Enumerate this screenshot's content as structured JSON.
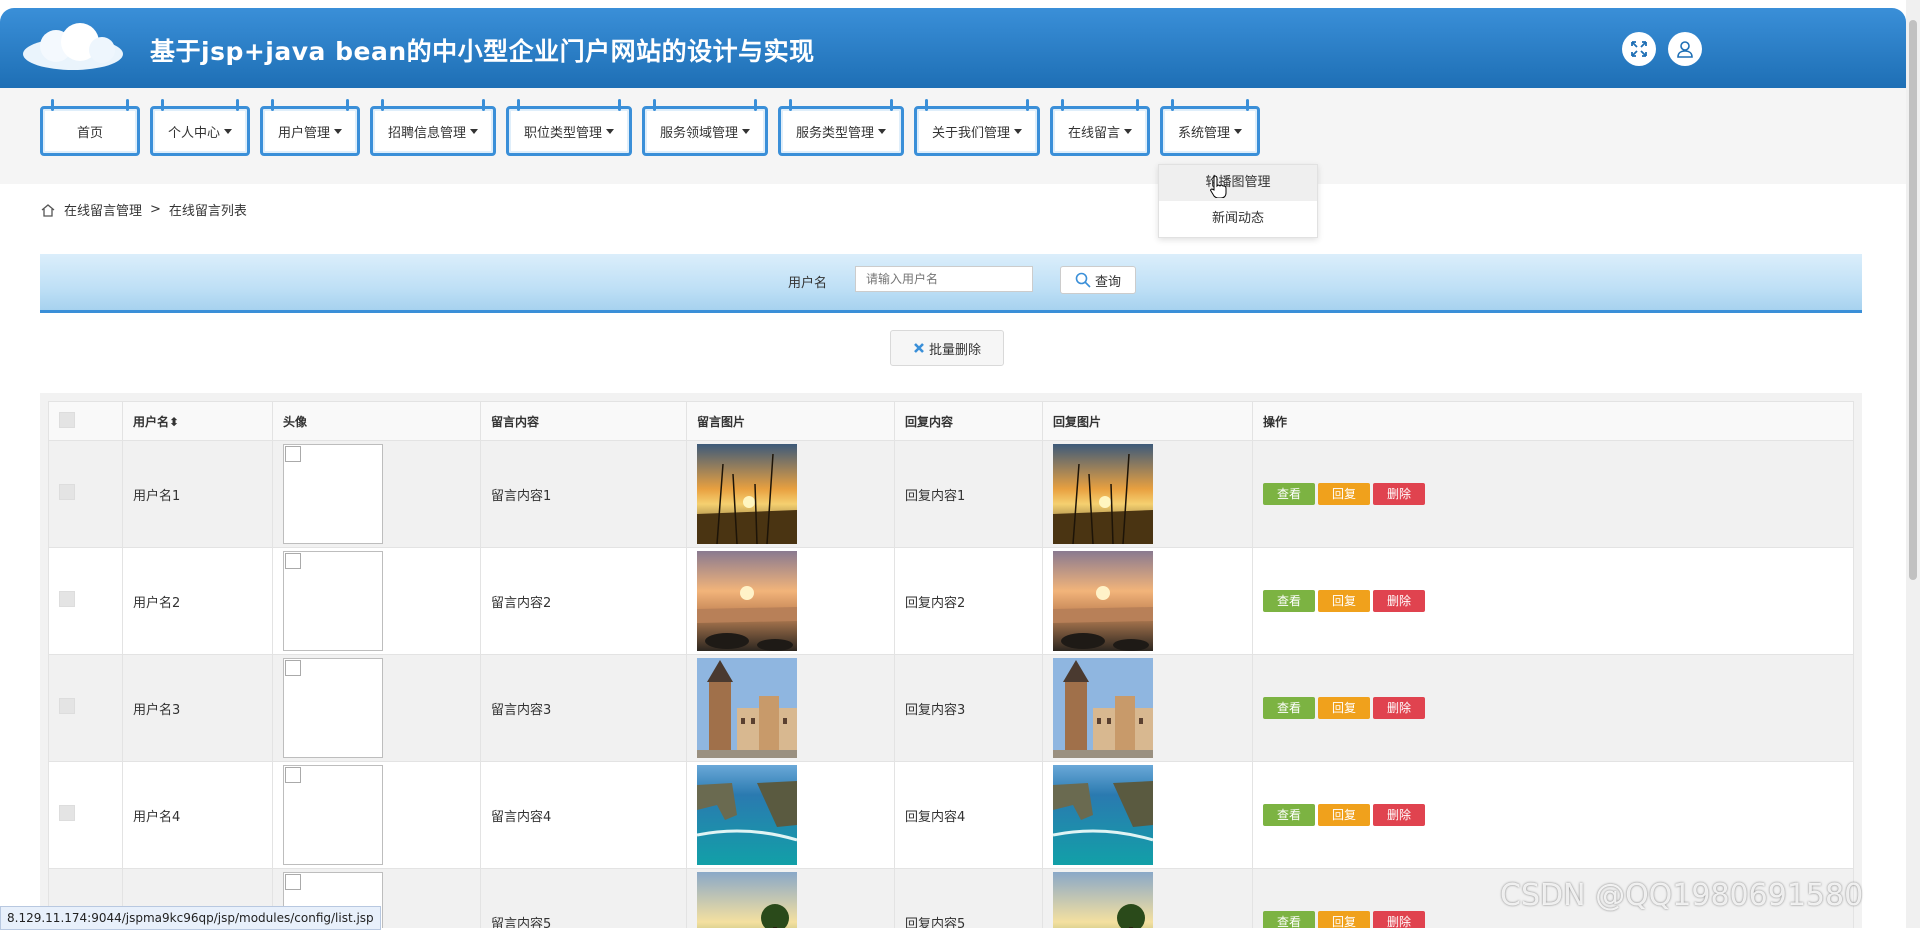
{
  "header": {
    "title": "基于jsp+java bean的中小型企业门户网站的设计与实现"
  },
  "nav": {
    "items": [
      {
        "label": "首页",
        "caret": false
      },
      {
        "label": "个人中心",
        "caret": true
      },
      {
        "label": "用户管理",
        "caret": true
      },
      {
        "label": "招聘信息管理",
        "caret": true
      },
      {
        "label": "职位类型管理",
        "caret": true
      },
      {
        "label": "服务领域管理",
        "caret": true
      },
      {
        "label": "服务类型管理",
        "caret": true
      },
      {
        "label": "关于我们管理",
        "caret": true
      },
      {
        "label": "在线留言",
        "caret": true
      },
      {
        "label": "系统管理",
        "caret": true
      }
    ],
    "dropdown": [
      "轮播图管理",
      "新闻动态"
    ]
  },
  "breadcrumb": {
    "parent": "在线留言管理",
    "separator": ">",
    "current": "在线留言列表"
  },
  "search": {
    "label": "用户名",
    "placeholder": "请输入用户名",
    "button": "查询"
  },
  "batch_delete": "批量删除",
  "table": {
    "headers": [
      "用户名",
      "头像",
      "留言内容",
      "留言图片",
      "回复内容",
      "回复图片",
      "操作"
    ],
    "rows": [
      {
        "username": "用户名1",
        "message": "留言内容1",
        "reply": "回复内容1",
        "img": "sunset-field"
      },
      {
        "username": "用户名2",
        "message": "留言内容2",
        "reply": "回复内容2",
        "img": "sea-sunset"
      },
      {
        "username": "用户名3",
        "message": "留言内容3",
        "reply": "回复内容3",
        "img": "castle"
      },
      {
        "username": "用户名4",
        "message": "留言内容4",
        "reply": "回复内容4",
        "img": "sea-arch"
      },
      {
        "username": "",
        "message": "留言内容5",
        "reply": "回复内容5",
        "img": "tree-meadow"
      }
    ],
    "actions": {
      "view": "查看",
      "reply": "回复",
      "delete": "删除"
    }
  },
  "status_url": "8.129.11.174:9044/jspma9kc96qp/jsp/modules/config/list.jsp",
  "watermark": "CSDN @QQ1980691580"
}
